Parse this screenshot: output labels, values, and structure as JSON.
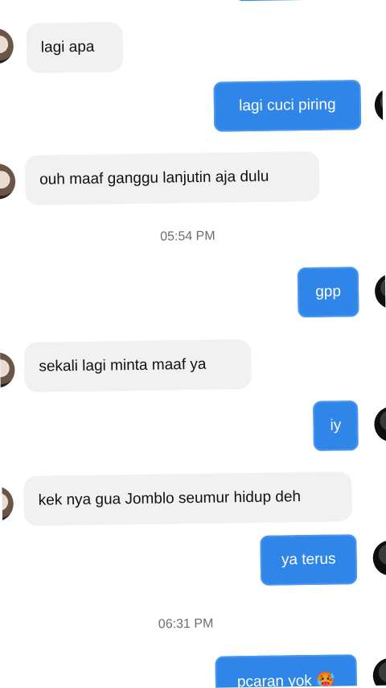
{
  "messages": [
    {
      "text": "lagi apa",
      "side": "in"
    },
    {
      "text": "lagi cuci piring",
      "side": "out"
    },
    {
      "text": "ouh maaf ganggu lanjutin aja dulu",
      "side": "in"
    },
    {
      "text": "gpp",
      "side": "out"
    },
    {
      "text": "sekali lagi minta maaf ya",
      "side": "in"
    },
    {
      "text": "iy",
      "side": "out"
    },
    {
      "text": "kek nya gua Jomblo seumur hidup deh",
      "side": "in"
    },
    {
      "text": "ya terus",
      "side": "out"
    },
    {
      "text": "pcaran yok 🥵",
      "side": "out"
    }
  ],
  "timestamps": [
    "05:54 PM",
    "06:31 PM"
  ],
  "colors": {
    "sent_bubble": "#2f86e8",
    "received_bubble": "#f1f1f1",
    "background": "#ffffff"
  }
}
